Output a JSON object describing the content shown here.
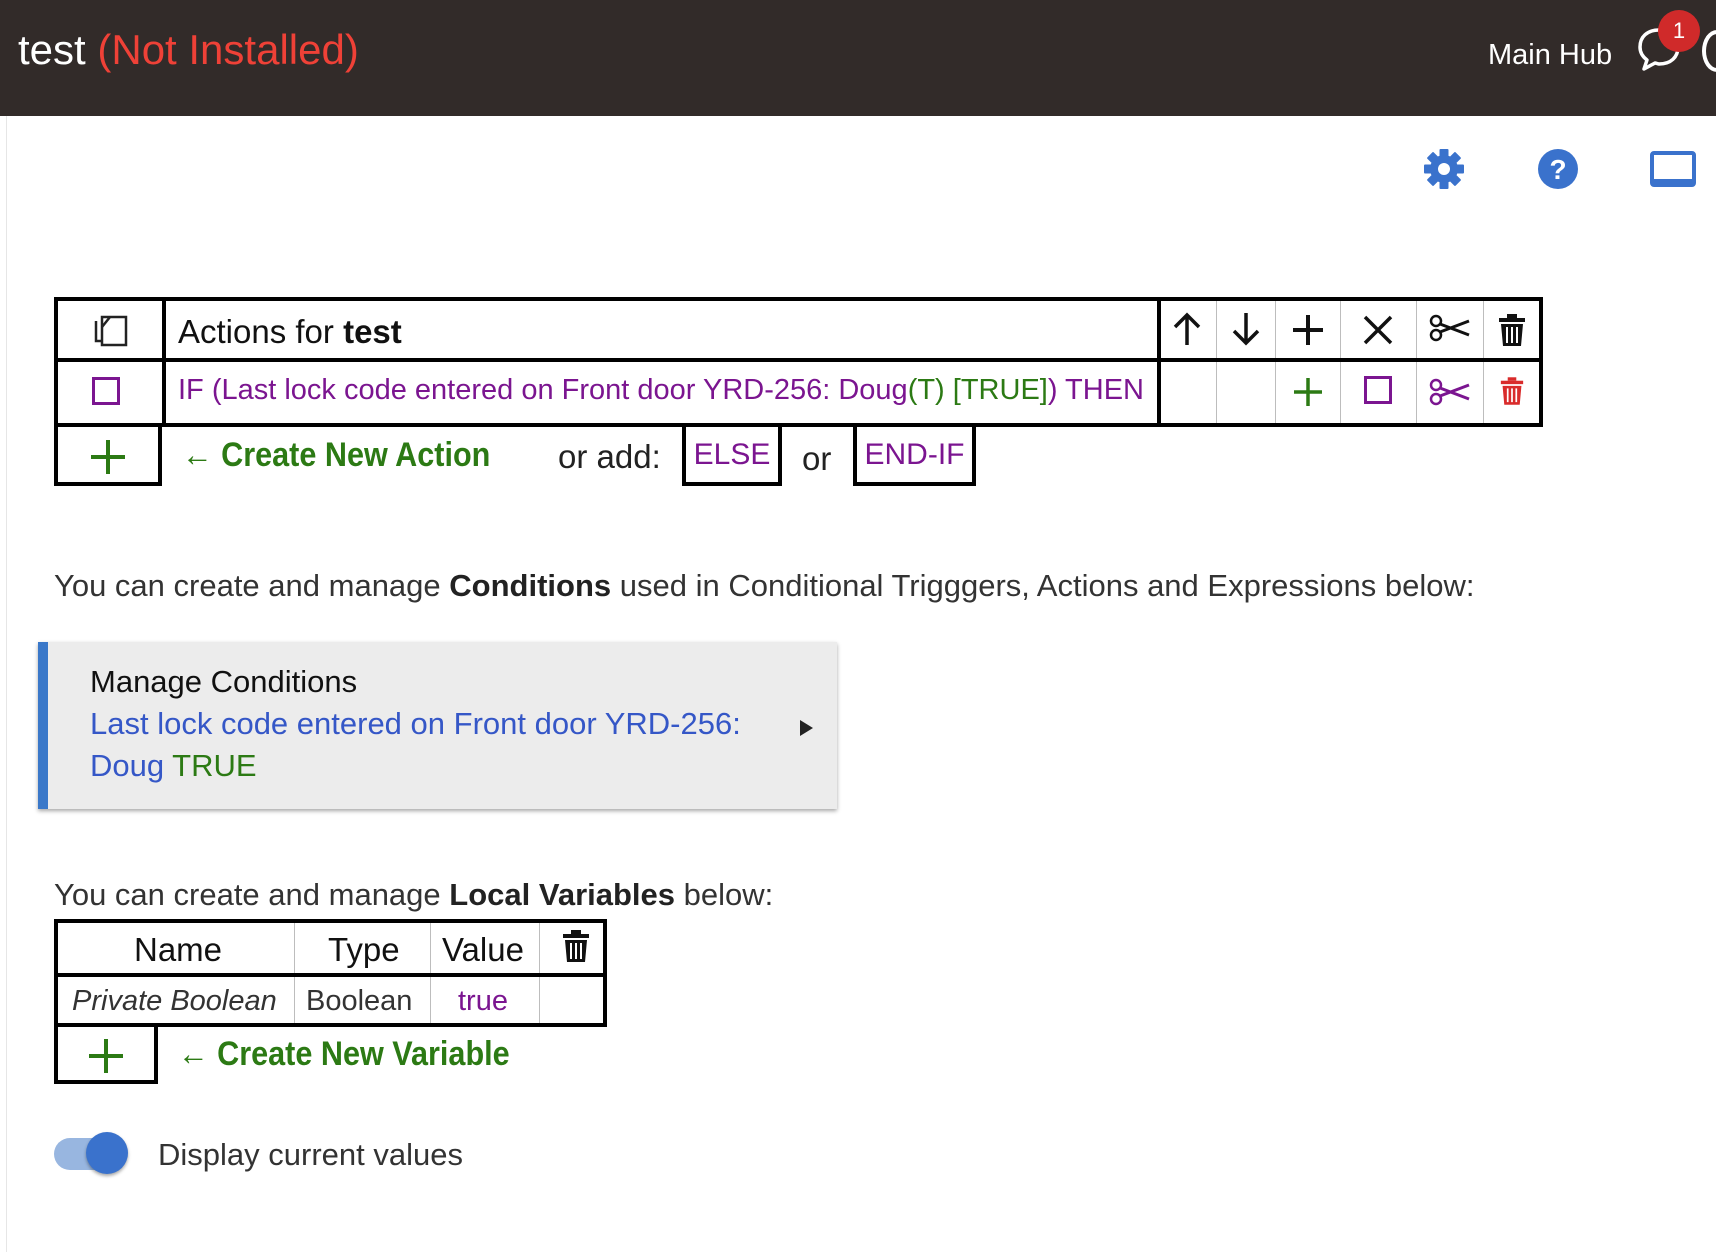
{
  "header": {
    "app_name": "test",
    "status": "(Not Installed)",
    "hub_name": "Main Hub",
    "notification_count": "1"
  },
  "toolbar": {
    "icons": [
      "gear-icon",
      "help-icon",
      "display-icon"
    ],
    "colors": {
      "accent": "#3a78c9"
    }
  },
  "actions_table": {
    "title_prefix": "Actions for",
    "title_name": "test",
    "rows": [
      {
        "text_purple": "IF (Last lock code entered on Front door YRD-256: Doug",
        "text_green_t": "(T)",
        "text_green_true": "[TRUE]",
        "text_purple_end": ") THEN"
      }
    ],
    "create_label": "Create New Action",
    "or_add_label": "or add:",
    "else_label": "ELSE",
    "or_label": "or",
    "endif_label": "END-IF"
  },
  "conditions_info": {
    "prefix": "You can create and manage",
    "bold": "Conditions",
    "suffix": "used in Conditional Trigggers, Actions and Expressions below:"
  },
  "conditions_card": {
    "title": "Manage Conditions",
    "line1": "Last lock code entered on Front door YRD-256:",
    "line2_name": "Doug",
    "line2_value": "TRUE"
  },
  "variables_info": {
    "prefix": "You can create and manage",
    "bold": "Local Variables",
    "suffix": "below:"
  },
  "variables_table": {
    "headers": [
      "Name",
      "Type",
      "Value"
    ],
    "rows": [
      {
        "name": "Private Boolean",
        "type": "Boolean",
        "value": "true"
      }
    ],
    "create_label": "Create New Variable"
  },
  "display_toggle": {
    "label": "Display current values",
    "on": true
  }
}
